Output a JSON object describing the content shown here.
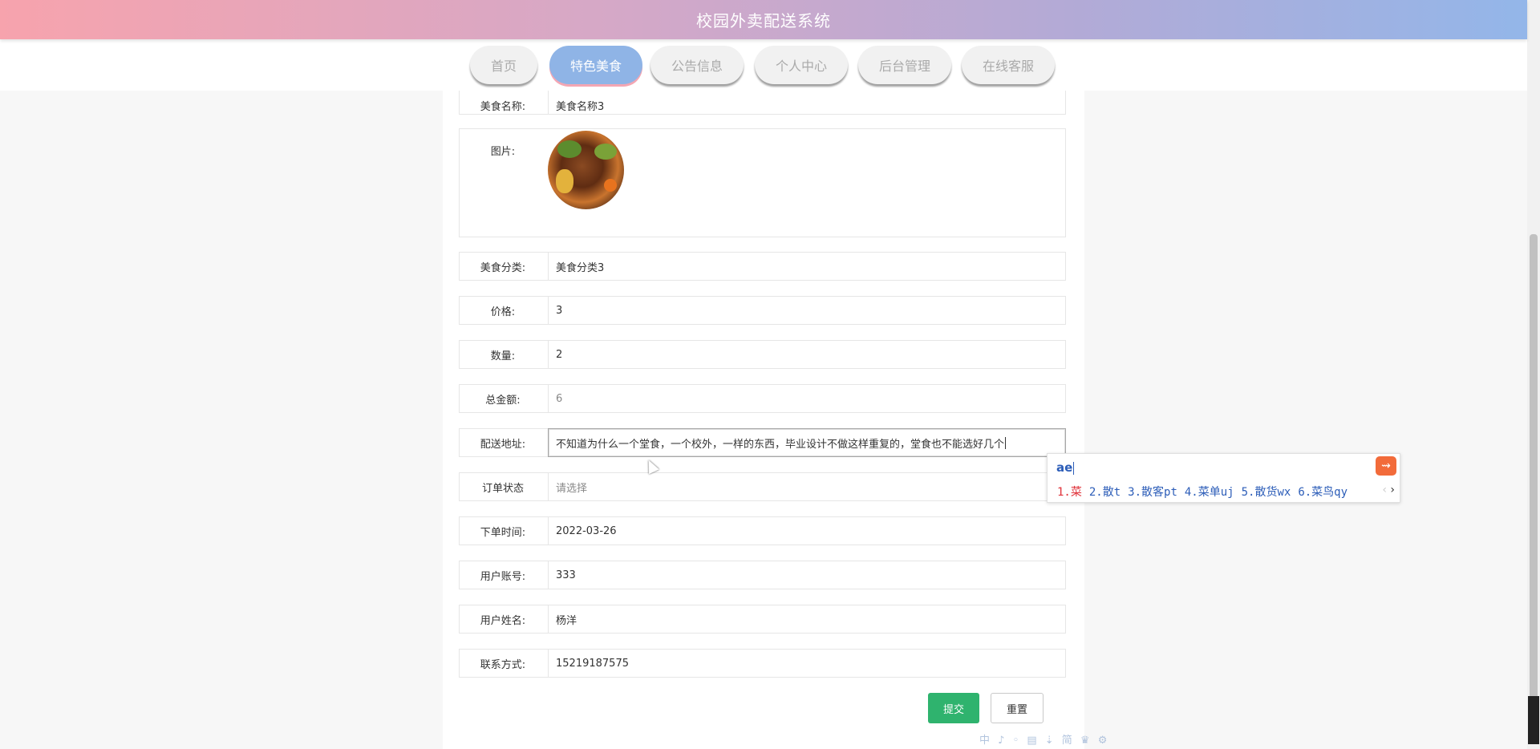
{
  "header": {
    "title": "校园外卖配送系统"
  },
  "nav": {
    "items": [
      {
        "label": "首页",
        "active": false
      },
      {
        "label": "特色美食",
        "active": true
      },
      {
        "label": "公告信息",
        "active": false
      },
      {
        "label": "个人中心",
        "active": false
      },
      {
        "label": "后台管理",
        "active": false
      },
      {
        "label": "在线客服",
        "active": false
      }
    ]
  },
  "form": {
    "food_name": {
      "label": "美食名称:",
      "value": "美食名称3"
    },
    "image": {
      "label": "图片:"
    },
    "category": {
      "label": "美食分类:",
      "value": "美食分类3"
    },
    "price": {
      "label": "价格:",
      "value": "3"
    },
    "quantity": {
      "label": "数量:",
      "value": "2"
    },
    "total": {
      "label": "总金额:",
      "value": "6"
    },
    "address": {
      "label": "配送地址:",
      "value": "不知道为什么一个堂食，一个校外，一样的东西，毕业设计不做这样重复的，堂食也不能选好几个"
    },
    "status": {
      "label": "订单状态",
      "placeholder": "请选择"
    },
    "order_time": {
      "label": "下单时间:",
      "value": "2022-03-26"
    },
    "account": {
      "label": "用户账号:",
      "value": "333"
    },
    "username": {
      "label": "用户姓名:",
      "value": "杨洋"
    },
    "contact": {
      "label": "联系方式:",
      "value": "15219187575"
    },
    "submit_label": "提交",
    "reset_label": "重置"
  },
  "ime": {
    "composition": "ae",
    "candidates": [
      "1.菜",
      "2.散t",
      "3.散客pt",
      "4.菜单uj",
      "5.散货wx",
      "6.菜鸟qy"
    ]
  },
  "toolbar": {
    "text": "中 ♪ ◦ ▤ ⇣ 简 ♛ ⚙"
  },
  "colors": {
    "header_gradient_start": "#f7a3ad",
    "header_gradient_end": "#93b6e9",
    "nav_active": "#8fb4e6",
    "submit_button": "#2fb36e",
    "ime_highlight": "#e0323a",
    "ime_text": "#2c5db8"
  }
}
